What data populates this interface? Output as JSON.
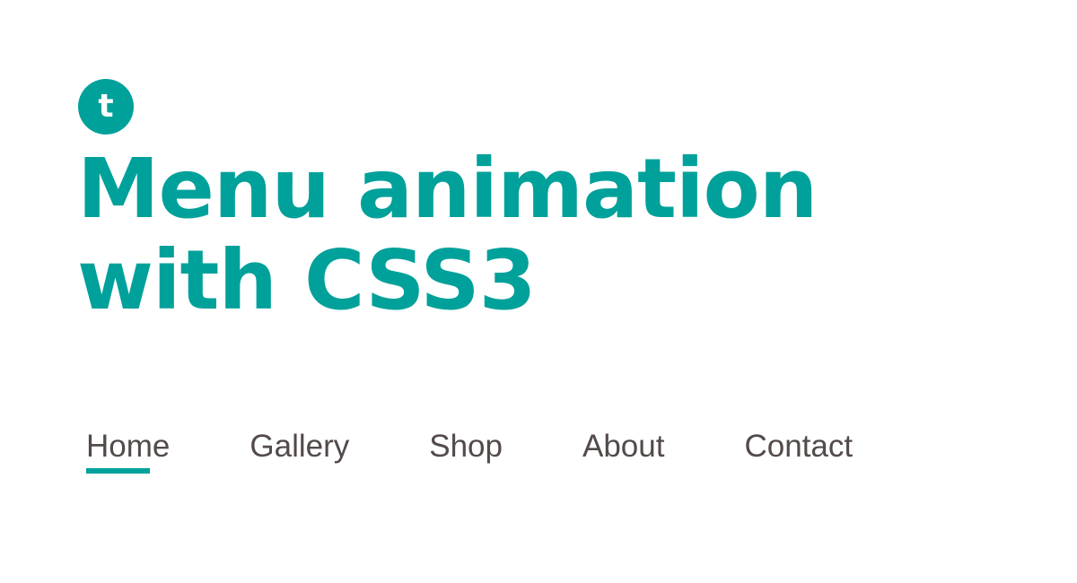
{
  "logo": {
    "letter": "t"
  },
  "title": {
    "line1": "Menu animation",
    "line2": "with CSS3"
  },
  "nav": {
    "items": [
      {
        "label": "Home",
        "active": true
      },
      {
        "label": "Gallery",
        "active": false
      },
      {
        "label": "Shop",
        "active": false
      },
      {
        "label": "About",
        "active": false
      },
      {
        "label": "Contact",
        "active": false
      }
    ]
  },
  "colors": {
    "accent": "#00a19a",
    "nav_text": "#534a4a",
    "background": "#ffffff"
  }
}
